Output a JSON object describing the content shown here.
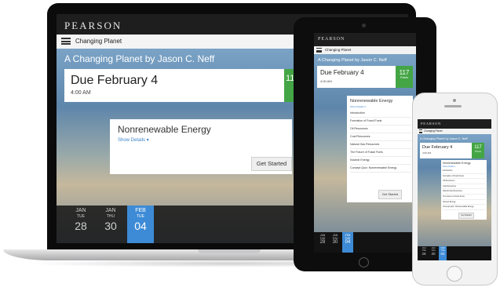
{
  "brand": "PEARSON",
  "course_title": "Changing Planet",
  "assignment_title": "A Changing Planet by Jason C. Neff",
  "due": {
    "label": "Due February 4",
    "time": "4:00 AM"
  },
  "points": {
    "value": "117",
    "label": "Points"
  },
  "task": {
    "title": "Nonrenewable Energy",
    "show_details": "Show Details ▾",
    "start_button": "Get Started",
    "items": [
      "Introduction",
      "Formation of Fossil Fuels",
      "Oil Resources",
      "Coal Resources",
      "Natural Gas Resources",
      "The Future of Fossil Fuels",
      "Nuclear Energy",
      "Concept Quiz: Nonrenewable Energy"
    ]
  },
  "dates": [
    {
      "month": "JAN",
      "weekday": "TUE",
      "day": "28",
      "active": false
    },
    {
      "month": "JAN",
      "weekday": "THU",
      "day": "30",
      "active": false
    },
    {
      "month": "FEB",
      "weekday": "TUE",
      "day": "04",
      "active": true
    }
  ],
  "colors": {
    "header_bg": "#1e1e1e",
    "points_green": "#44a545",
    "active_date_blue": "#3d8bd6",
    "link_blue": "#3a85c9"
  },
  "icons": {
    "menu": "hamburger-menu-icon"
  }
}
